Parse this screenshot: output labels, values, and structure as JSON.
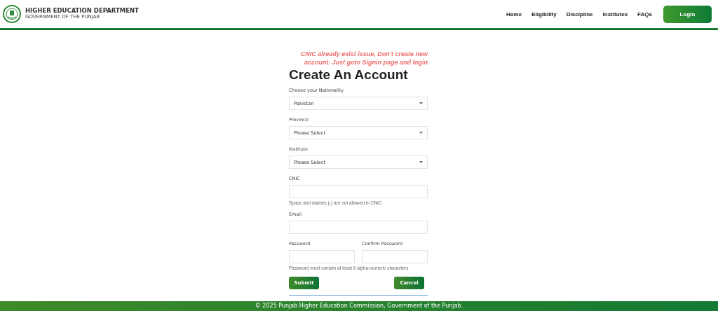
{
  "brand": {
    "title": "HIGHER EDUCATION DEPARTMENT",
    "subtitle": "GOVERNMENT OF THE PUNJAB"
  },
  "nav": [
    {
      "label": "Home"
    },
    {
      "label": "Eligibility"
    },
    {
      "label": "Discipline"
    },
    {
      "label": "Institutes"
    },
    {
      "label": "FAQs"
    }
  ],
  "login_button": "Login",
  "notice": "CNIC already exist issue, Don't create new account. Just goto Signin page and login",
  "heading": "Create An Account",
  "fields": [
    {
      "kind": "select",
      "label": "Choose your Nationality",
      "value": "Pakistan"
    },
    {
      "kind": "select",
      "label": "Province",
      "value": "Please Select"
    },
    {
      "kind": "select",
      "label": "Institute",
      "value": "Please Select"
    },
    {
      "kind": "input",
      "label": "CNIC",
      "hint": "Space and dashes (-) are not allowed in CNIC"
    },
    {
      "kind": "input",
      "label": "Email"
    },
    {
      "kind": "pair",
      "items": [
        {
          "label": "Password"
        },
        {
          "label": "Confirm Password"
        }
      ],
      "hint": "Password must contain at least 6 alpha-numeric characters"
    }
  ],
  "buttons": [
    "Submit",
    "Cancel"
  ],
  "footer": "© 2025 Punjab Higher Education Commission, Government of the Punjab."
}
